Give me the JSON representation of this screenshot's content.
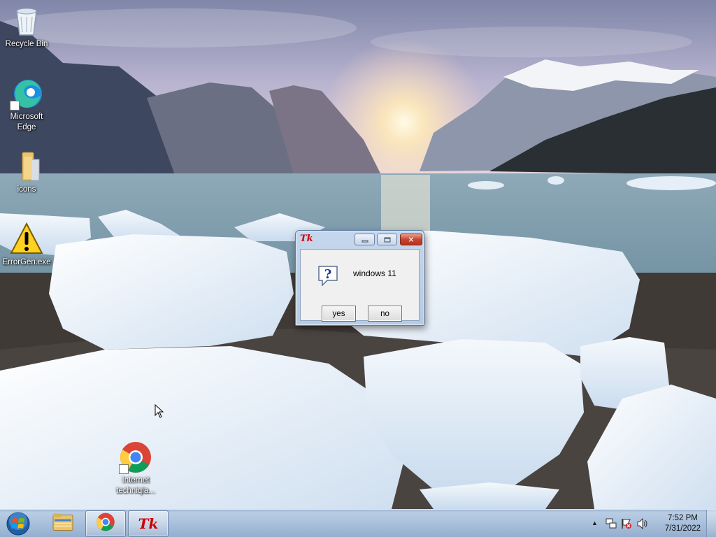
{
  "desktop": {
    "icons": [
      {
        "label": "Recycle Bin"
      },
      {
        "label": "Microsoft Edge"
      },
      {
        "label": "icons"
      },
      {
        "label": "ErrorGen.exe"
      },
      {
        "label": "Internet techniqia..."
      }
    ]
  },
  "dialog": {
    "app_icon_text": "Tk",
    "message": "windows 11",
    "yes_label": "yes",
    "no_label": "no",
    "icon": "question-icon"
  },
  "taskbar": {
    "items": [
      {
        "name": "windows-explorer",
        "icon": "folder-icon"
      },
      {
        "name": "chrome",
        "icon": "chrome-icon"
      },
      {
        "name": "tk-app",
        "icon": "tk-icon",
        "text": "Tk"
      }
    ],
    "tray": {
      "time": "7:52 PM",
      "date": "7/31/2022",
      "overflow_glyph": "▲"
    }
  },
  "colors": {
    "taskbar": "#a9c0dc",
    "dialog_frame": "#b6cbe4",
    "close_button": "#c8442d",
    "tk_red": "#cc0000"
  }
}
